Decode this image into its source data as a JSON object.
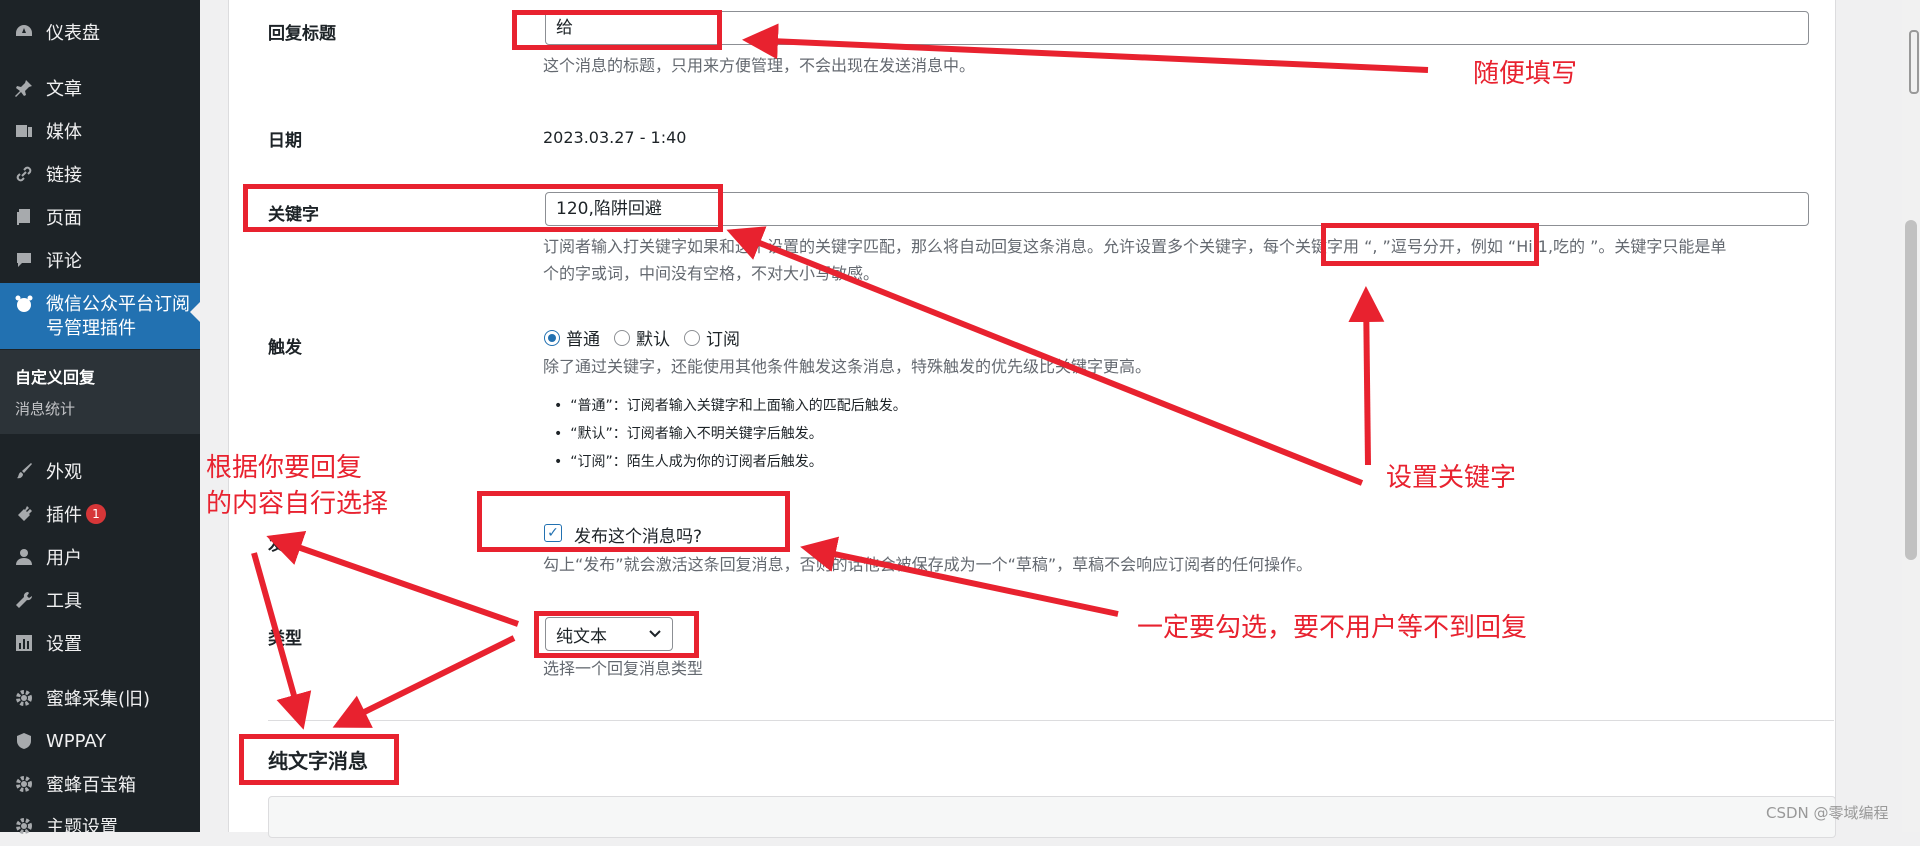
{
  "sidebar": {
    "items": [
      {
        "label": "仪表盘",
        "icon": "dashboard-icon"
      },
      {
        "label": "文章",
        "icon": "pin-icon"
      },
      {
        "label": "媒体",
        "icon": "media-icon"
      },
      {
        "label": "链接",
        "icon": "link-icon"
      },
      {
        "label": "页面",
        "icon": "page-icon"
      },
      {
        "label": "评论",
        "icon": "comment-icon"
      },
      {
        "label": "微信公众平台订阅号管理插件",
        "icon": "wechat-icon"
      },
      {
        "label": "外观",
        "icon": "brush-icon"
      },
      {
        "label": "插件",
        "icon": "plugin-icon",
        "badge": "1"
      },
      {
        "label": "用户",
        "icon": "user-icon"
      },
      {
        "label": "工具",
        "icon": "wrench-icon"
      },
      {
        "label": "设置",
        "icon": "settings-icon"
      },
      {
        "label": "蜜蜂采集(旧)",
        "icon": "gear-icon"
      },
      {
        "label": "WPPAY",
        "icon": "shield-icon"
      },
      {
        "label": "蜜蜂百宝箱",
        "icon": "gear-icon"
      },
      {
        "label": "主题设置",
        "icon": "gear-icon"
      }
    ],
    "submenu": [
      {
        "label": "自定义回复"
      },
      {
        "label": "消息统计"
      }
    ]
  },
  "form": {
    "reply_title": {
      "label": "回复标题",
      "value": "给",
      "desc": "这个消息的标题，只用来方便管理，不会出现在发送消息中。"
    },
    "date": {
      "label": "日期",
      "value": "2023.03.27 - 1:40"
    },
    "keyword": {
      "label": "关键字",
      "value": "120,陷阱回避",
      "desc_line1": "订阅者输入打关键字如果和这个设置的关键字匹配，那么将自动回复这条消息。允许设置多个关键字，每个关键字用 “, ”逗号分开，例如 “Hi,1,吃的 ”。关键字只能是单",
      "desc_line2": "个的字或词，中间没有空格，不对大小写敏感。"
    },
    "trigger": {
      "label": "触发",
      "options": [
        "普通",
        "默认",
        "订阅"
      ],
      "selected": "普通",
      "desc": "除了通过关键字，还能使用其他条件触发这条消息，特殊触发的优先级比关键字更高。",
      "bullets": [
        "“普通”：订阅者输入关键字和上面输入的匹配后触发。",
        "“默认”：订阅者输入不明关键字后触发。",
        "“订阅”：陌生人成为你的订阅者后触发。"
      ]
    },
    "publish": {
      "label": "发布",
      "checkbox_label": "发布这个消息吗?",
      "checked": true,
      "desc": "勾上“发布”就会激活这条回复消息，否则的话他会被保存成为一个“草稿”，草稿不会响应订阅者的任何操作。"
    },
    "type": {
      "label": "类型",
      "selected": "纯文本",
      "desc": "选择一个回复消息类型"
    },
    "section_title": "纯文字消息"
  },
  "annotations": {
    "a1": "随便填写",
    "a2": "设置关键字",
    "a3_line1": "根据你要回复",
    "a3_line2": "的内容自行选择",
    "a4": "一定要勾选，要不用户等不到回复",
    "color": "#e8222f"
  },
  "watermark": "CSDN @零域编程"
}
